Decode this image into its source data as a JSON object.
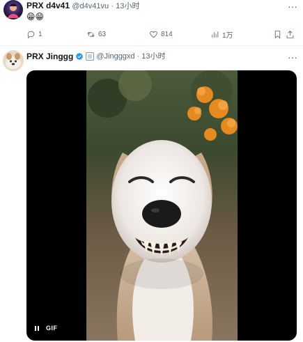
{
  "tweet1": {
    "name": "PRX d4v41",
    "handle": "@d4v41vu",
    "sep": " · ",
    "time": "13小时",
    "more": "···",
    "content": "😁😁",
    "actions": {
      "reply": "1",
      "retweet": "63",
      "like": "814",
      "views": "1万"
    }
  },
  "tweet2": {
    "name": "PRX Jinggg",
    "handle": "@Jingggxd",
    "sep": " · ",
    "time": "13小时",
    "more": "···",
    "media": {
      "badge": "GIF"
    }
  },
  "colors": {
    "text_primary": "#0f1419",
    "text_secondary": "#536471",
    "verified_blue": "#1d9bf0",
    "divider": "#eff3f4",
    "media_bg": "#000000"
  },
  "icons": {
    "reply": "reply-icon",
    "retweet": "retweet-icon",
    "like": "heart-icon",
    "views": "views-icon",
    "bookmark": "bookmark-icon",
    "share": "share-icon",
    "verified": "verified-icon",
    "pause": "pause-icon"
  }
}
